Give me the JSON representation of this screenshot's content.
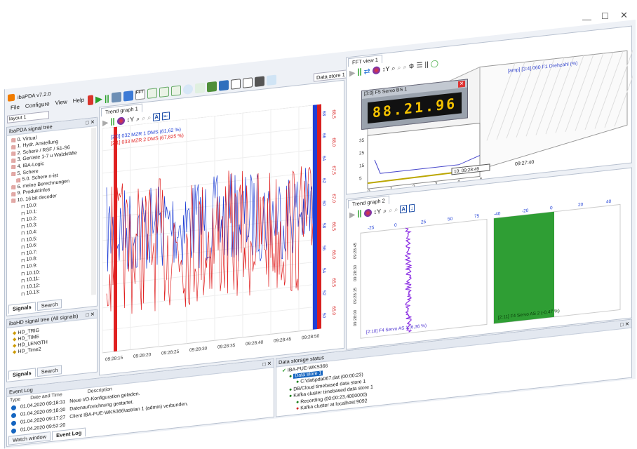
{
  "window": {
    "title": "ibaPDA v7.2.0",
    "controls": [
      "minimize-icon",
      "maximize-icon",
      "close-icon"
    ]
  },
  "menu": [
    "File",
    "Configure",
    "View",
    "Help"
  ],
  "layout_selector": "layout 1",
  "data_store_selector": "Data store 1",
  "signal_tree": {
    "title": "ibaPDA signal tree",
    "items": [
      {
        "label": "0. Virtual",
        "indent": 0
      },
      {
        "label": "1. Hydr. Anstellung",
        "indent": 0
      },
      {
        "label": "2. Schere / RSF / S1-S6",
        "indent": 0
      },
      {
        "label": "3. Gerüste 1-7  u  Walzkräfte",
        "indent": 0
      },
      {
        "label": "4. IBA-Logic",
        "indent": 0
      },
      {
        "label": "5. Schere",
        "indent": 0
      },
      {
        "label": "5.0. Schere n-ist",
        "indent": 1
      },
      {
        "label": "6. meine Berechnungen",
        "indent": 0
      },
      {
        "label": "9. Produktinfos",
        "indent": 0
      },
      {
        "label": "10. 16 bit decoder",
        "indent": 0
      },
      {
        "label": "10.0:",
        "indent": 2
      },
      {
        "label": "10.1:",
        "indent": 2
      },
      {
        "label": "10.2:",
        "indent": 2
      },
      {
        "label": "10.3:",
        "indent": 2
      },
      {
        "label": "10.4:",
        "indent": 2
      },
      {
        "label": "10.5:",
        "indent": 2
      },
      {
        "label": "10.6:",
        "indent": 2
      },
      {
        "label": "10.7:",
        "indent": 2
      },
      {
        "label": "10.8:",
        "indent": 2
      },
      {
        "label": "10.9:",
        "indent": 2
      },
      {
        "label": "10.10:",
        "indent": 2
      },
      {
        "label": "10.11:",
        "indent": 2
      },
      {
        "label": "10.12:",
        "indent": 2
      },
      {
        "label": "10.13:",
        "indent": 2
      }
    ],
    "tabs": [
      "Signals",
      "Search"
    ]
  },
  "hd_tree": {
    "title": "ibaHD signal tree (All signals)",
    "items": [
      "HD_TRIG",
      "HD_TIME",
      "HD_LENGTH",
      "HD_Time2"
    ],
    "tabs": [
      "Signals",
      "Search"
    ]
  },
  "trend1": {
    "tab": "Trend graph 1",
    "legend": [
      {
        "label": "[2:0] 032 MZR 1   DMS (61,62 %)",
        "color": "#1f3fd6"
      },
      {
        "label": "[2:1] 033 MZR 2   DMS (67,825 %)",
        "color": "#e02020"
      }
    ],
    "x_ticks": [
      "09:28:15",
      "09:28:20",
      "09:28:25",
      "09:28:30",
      "09:28:35",
      "09:28:40",
      "09:28:45",
      "09:28:50"
    ],
    "y_ticks_blue": [
      "68",
      "66",
      "64",
      "62",
      "60",
      "58",
      "56",
      "54",
      "52",
      "50"
    ],
    "y_ticks_red": [
      "68,5",
      "68,0",
      "67,5",
      "67,0",
      "66,5",
      "66,0",
      "65,5",
      "65,0"
    ]
  },
  "fft": {
    "tab": "FFT view 1",
    "legend": "[amp] [3:4] 060 F1 Drehzahl (%)",
    "y_ticks": [
      "35",
      "25",
      "15",
      "5"
    ],
    "x_ticks": [
      "0",
      "1",
      "2",
      "3",
      "4",
      "5"
    ],
    "time_box": "10: 09:28:49",
    "time_label": "09:27:40"
  },
  "digital_display": {
    "title": "[3:0] F5 Servo BS 1",
    "value": "88.21.96"
  },
  "trend2": {
    "tab": "Trend graph 2",
    "left_ticks": [
      "-25",
      "0",
      "25",
      "50",
      "75"
    ],
    "right_ticks": [
      "-40",
      "-20",
      "0",
      "20",
      "40"
    ],
    "y_ticks": [
      "09:28:45",
      "09:28:30",
      "09:28:15",
      "09:28:00"
    ],
    "left_label": "[2:10] F4 Servo AS 1 (6,36 %)",
    "right_label": "[2:11] F4 Servo AS 2 (-0,47 %)"
  },
  "event_log": {
    "title": "Event Log",
    "columns": [
      "Type",
      "Date and Time",
      "Description"
    ],
    "rows": [
      {
        "time": "01.04.2020 09:18:31",
        "desc": "Neue I/O-Konfiguration geladen."
      },
      {
        "time": "01.04.2020 09:18:30",
        "desc": "Datenaufzeichnung gestartet."
      },
      {
        "time": "01.04.2020 09:17:27",
        "desc": "Client IBA-FUE-WKS366\\astrian 1 (admin) verbunden."
      },
      {
        "time": "01.04.2020 09:52:20",
        "desc": ""
      }
    ],
    "tabs": [
      "Watch window",
      "Event Log"
    ]
  },
  "storage": {
    "title": "Data storage status",
    "items": [
      {
        "label": "IBA-FUE-WKS366",
        "indent": 0
      },
      {
        "label": "Data store 1",
        "indent": 1
      },
      {
        "label": "C:\\dat\\pda067.dat (00:00:23)",
        "indent": 2
      },
      {
        "label": "DB/Cloud timebased data store 1",
        "indent": 1
      },
      {
        "label": "Kafka cluster timebased data store 1",
        "indent": 1
      },
      {
        "label": "Recording (00:00:23.4000000)",
        "indent": 2
      },
      {
        "label": "Kafka cluster at localhost:9092",
        "indent": 2
      }
    ]
  }
}
